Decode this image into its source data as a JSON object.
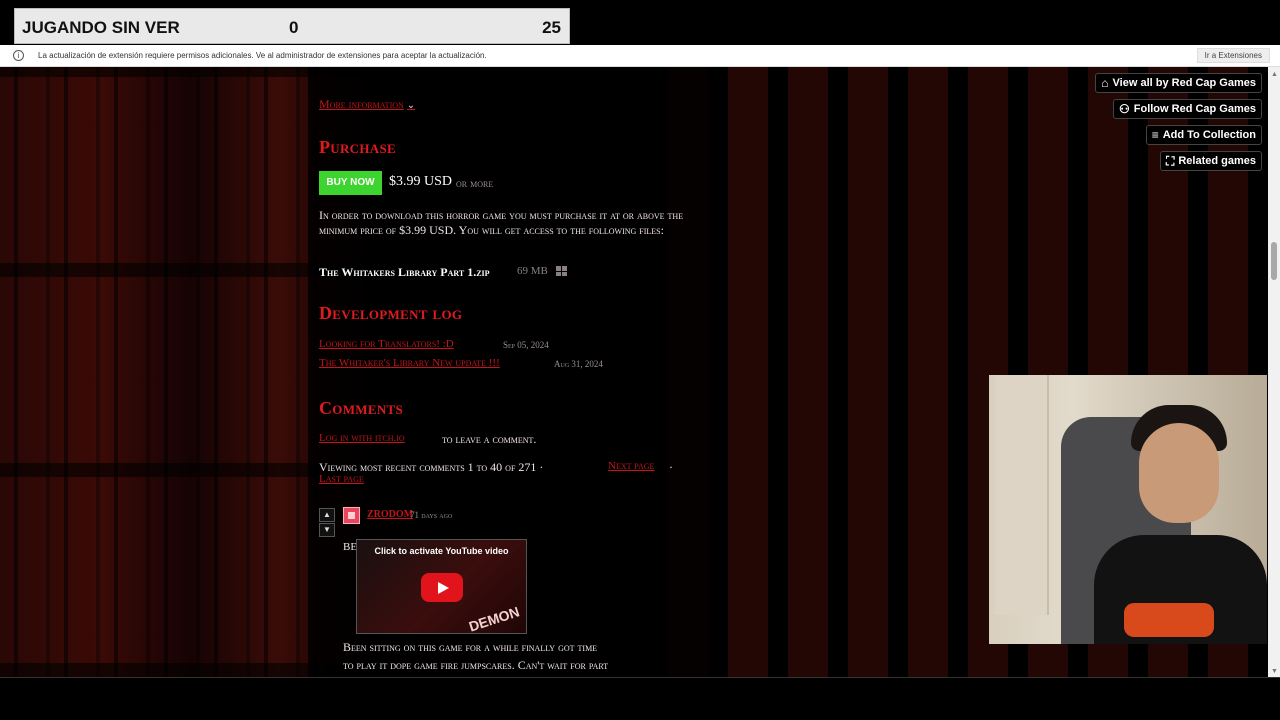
{
  "overlay": {
    "label": "JUGANDO SIN VER",
    "score_left": "0",
    "score_right": "25"
  },
  "browser_info": {
    "message": "La actualización de extensión requiere permisos adicionales. Ve al administrador de extensiones para aceptar la actualización.",
    "button": "Ir a Extensiones"
  },
  "sidebar": {
    "view_all": "View all by Red Cap Games",
    "follow": "Follow Red Cap Games",
    "add_collection": "Add To Collection",
    "related": "Related games"
  },
  "page": {
    "more_info": "More information",
    "purchase_heading": "Purchase",
    "buy_now": "BUY NOW",
    "price": "$3.99 USD",
    "or_more": "or more",
    "purchase_text": "In order to download this horror game you must purchase it at or above the minimum price of $3.99 USD. You will get access to the following files:",
    "file_name": "The Whitakers Library Part 1.zip",
    "file_size": "69 MB",
    "devlog_heading": "Development log",
    "devlog": [
      {
        "title": "Looking for Translators! :D",
        "date": "Sep 05, 2024"
      },
      {
        "title": "The Whitaker's Library New update !!!",
        "date": "Aug 31, 2024"
      }
    ],
    "comments_heading": "Comments",
    "login_link": "Log in with itch.io",
    "login_suffix": "to leave a comment.",
    "viewing_text": "Viewing most recent comments 1 to 40 of 271 ·",
    "next_page": "Next page",
    "sep": "·",
    "last_page": "Last page",
    "comment": {
      "username": "ZRODOM",
      "age": "71 days ago",
      "start": "BE",
      "body_line1": "Been sitting on this game for  a while finally got time",
      "body_line2": "to play it dope game fire jumpscares.  Can't wait for part"
    },
    "youtube": {
      "title": "Click to activate YouTube video",
      "brand": "DEMON"
    }
  }
}
